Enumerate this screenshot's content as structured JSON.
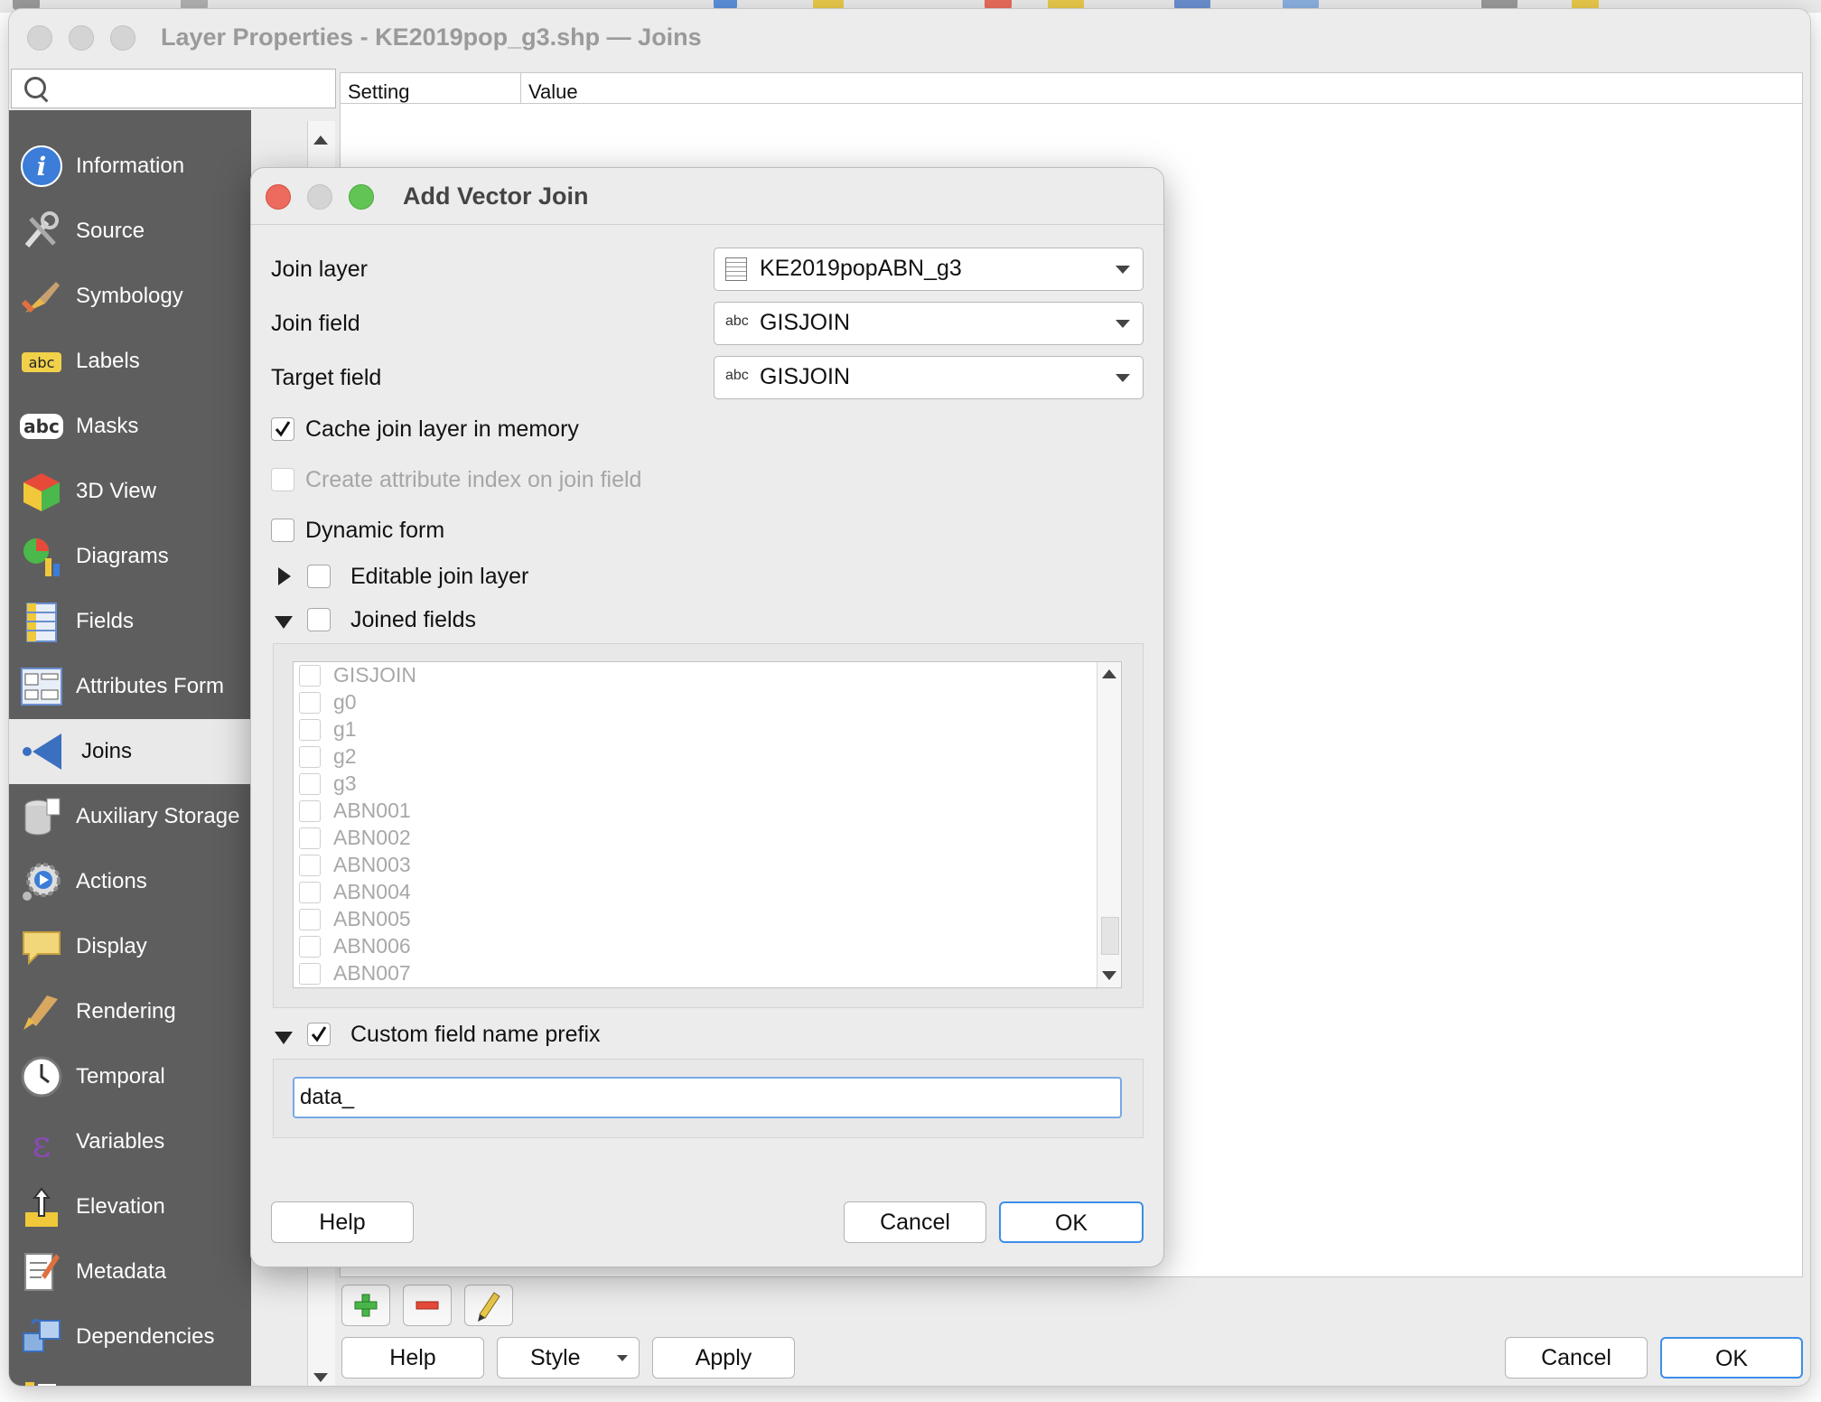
{
  "window": {
    "title": "Layer Properties - KE2019pop_g3.shp — Joins"
  },
  "search": {
    "value": "",
    "placeholder": ""
  },
  "sidebar": {
    "items": [
      {
        "label": "Information",
        "icon": "info-icon"
      },
      {
        "label": "Source",
        "icon": "source-icon"
      },
      {
        "label": "Symbology",
        "icon": "symbology-icon"
      },
      {
        "label": "Labels",
        "icon": "labels-icon"
      },
      {
        "label": "Masks",
        "icon": "masks-icon"
      },
      {
        "label": "3D View",
        "icon": "3d-view-icon"
      },
      {
        "label": "Diagrams",
        "icon": "diagrams-icon"
      },
      {
        "label": "Fields",
        "icon": "fields-icon"
      },
      {
        "label": "Attributes Form",
        "icon": "attributes-form-icon"
      },
      {
        "label": "Joins",
        "icon": "joins-icon",
        "selected": true
      },
      {
        "label": "Auxiliary Storage",
        "icon": "auxiliary-storage-icon"
      },
      {
        "label": "Actions",
        "icon": "actions-icon"
      },
      {
        "label": "Display",
        "icon": "display-icon"
      },
      {
        "label": "Rendering",
        "icon": "rendering-icon"
      },
      {
        "label": "Temporal",
        "icon": "temporal-icon"
      },
      {
        "label": "Variables",
        "icon": "variables-icon"
      },
      {
        "label": "Elevation",
        "icon": "elevation-icon"
      },
      {
        "label": "Metadata",
        "icon": "metadata-icon"
      },
      {
        "label": "Dependencies",
        "icon": "dependencies-icon"
      }
    ]
  },
  "table": {
    "columns": [
      "Setting",
      "Value"
    ]
  },
  "bottom_bar": {
    "help": "Help",
    "style": "Style",
    "apply": "Apply",
    "cancel": "Cancel",
    "ok": "OK"
  },
  "dialog": {
    "title": "Add Vector Join",
    "join_layer_label": "Join layer",
    "join_layer_value": "KE2019popABN_g3",
    "join_field_label": "Join field",
    "join_field_value": "GISJOIN",
    "target_field_label": "Target field",
    "target_field_value": "GISJOIN",
    "field_type_badge": "abc",
    "cache_label": "Cache join layer in memory",
    "cache_checked": true,
    "index_label": "Create attribute index on join field",
    "dynamic_form_label": "Dynamic form",
    "editable_label": "Editable join layer",
    "joined_fields_label": "Joined fields",
    "joined_fields": [
      "GISJOIN",
      "g0",
      "g1",
      "g2",
      "g3",
      "ABN001",
      "ABN002",
      "ABN003",
      "ABN004",
      "ABN005",
      "ABN006",
      "ABN007"
    ],
    "prefix_label": "Custom field name prefix",
    "prefix_value": "data_",
    "help": "Help",
    "cancel": "Cancel",
    "ok": "OK"
  },
  "colors": {
    "sidebar_bg": "#5e5e5e",
    "accent": "#3d8ee8",
    "close": "#ed6a5e",
    "zoom": "#61c454"
  }
}
